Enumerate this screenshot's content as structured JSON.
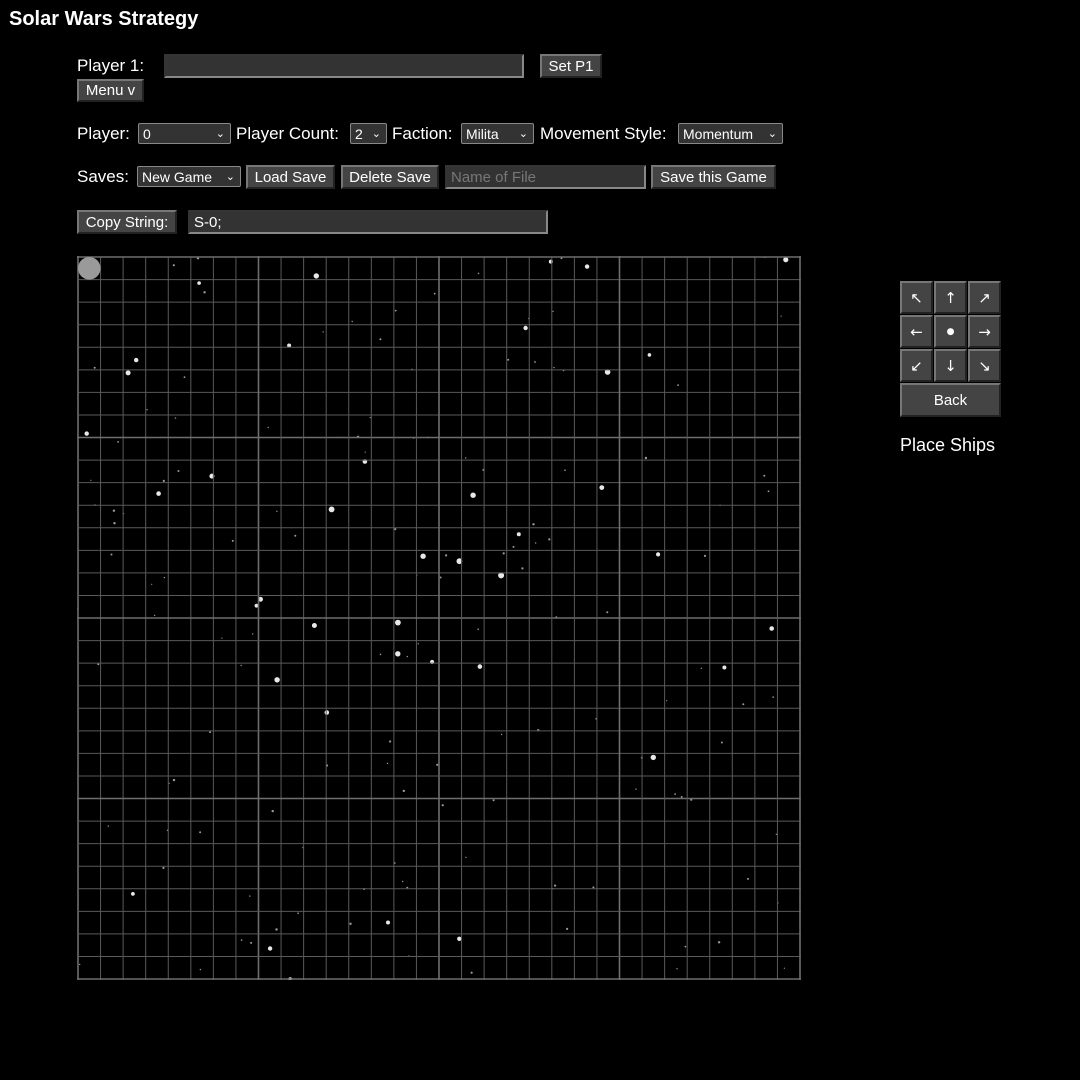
{
  "app": {
    "title": "Solar Wars Strategy"
  },
  "player1": {
    "label": "Player 1:",
    "value": "",
    "set_button": "Set P1"
  },
  "menu": {
    "label": "Menu v"
  },
  "settings": {
    "player_label": "Player:",
    "player_value": "0",
    "player_count_label": "Player Count:",
    "player_count_value": "2",
    "faction_label": "Faction:",
    "faction_value": "Milita",
    "movement_label": "Movement Style:",
    "movement_value": "Momentum"
  },
  "saves": {
    "label": "Saves:",
    "selected": "New Game",
    "load_button": "Load Save",
    "delete_button": "Delete Save",
    "file_placeholder": "Name of File",
    "save_button": "Save this Game"
  },
  "copy": {
    "button": "Copy String:",
    "value": "S-0;"
  },
  "board": {
    "cells": 32,
    "major_every": 8,
    "grid_color": "#5a5a5a",
    "major_color": "#6e6e6e",
    "marker": {
      "col": 0,
      "row": 0,
      "color": "#9a9a9a"
    }
  },
  "controls": {
    "arrows": [
      {
        "name": "arrow-up-left-icon",
        "glyph": "↖"
      },
      {
        "name": "arrow-up-icon",
        "glyph": "↑"
      },
      {
        "name": "arrow-up-right-icon",
        "glyph": "↗"
      },
      {
        "name": "arrow-left-icon",
        "glyph": "←"
      },
      {
        "name": "center-dot-icon",
        "glyph": "●"
      },
      {
        "name": "arrow-right-icon",
        "glyph": "→"
      },
      {
        "name": "arrow-down-left-icon",
        "glyph": "↙"
      },
      {
        "name": "arrow-down-icon",
        "glyph": "↓"
      },
      {
        "name": "arrow-down-right-icon",
        "glyph": "↘"
      }
    ],
    "back_button": "Back",
    "status": "Place Ships"
  },
  "colors": {
    "background": "#000000",
    "button": "#444444",
    "text": "#ffffff"
  }
}
